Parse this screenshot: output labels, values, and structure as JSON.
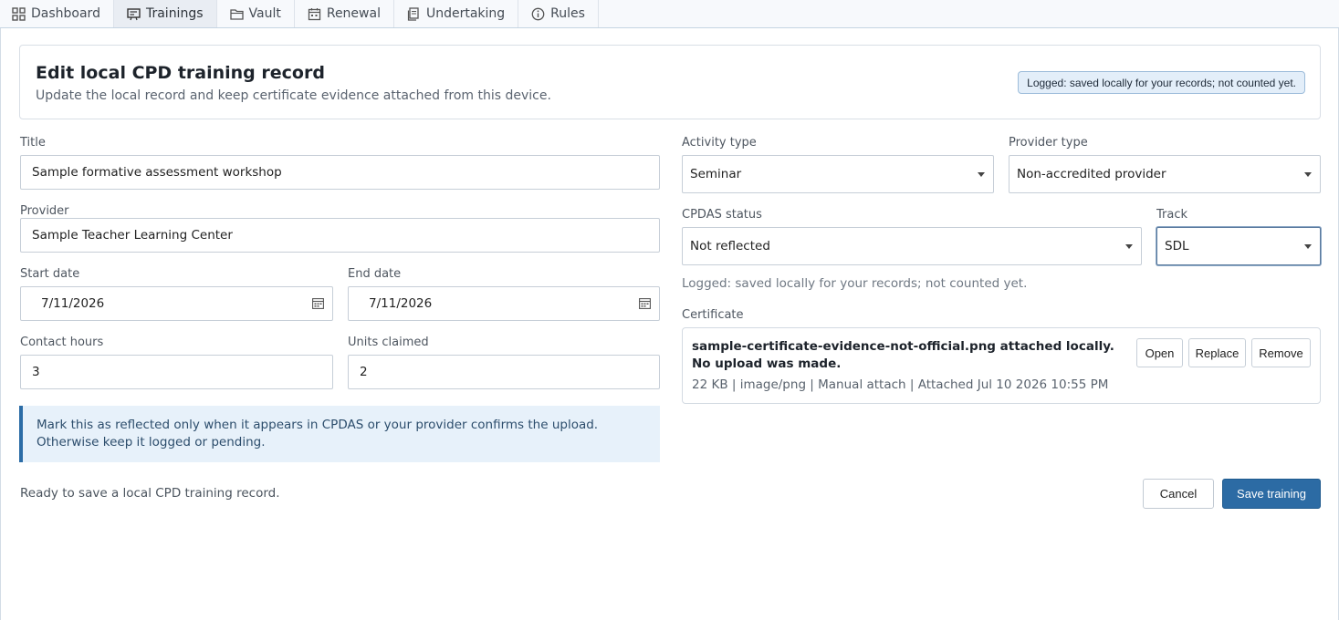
{
  "tabs": [
    {
      "label": "Dashboard",
      "icon": "grid-icon"
    },
    {
      "label": "Trainings",
      "icon": "training-icon",
      "active": true
    },
    {
      "label": "Vault",
      "icon": "folder-icon"
    },
    {
      "label": "Renewal",
      "icon": "calendar-icon"
    },
    {
      "label": "Undertaking",
      "icon": "document-icon"
    },
    {
      "label": "Rules",
      "icon": "info-icon"
    }
  ],
  "header": {
    "title": "Edit local CPD training record",
    "subtitle": "Update the local record and keep certificate evidence attached from this device.",
    "badge": "Logged: saved locally for your records; not counted yet."
  },
  "form": {
    "title": {
      "label": "Title",
      "value": "Sample formative assessment workshop"
    },
    "provider": {
      "label": "Provider",
      "value": "Sample Teacher Learning Center"
    },
    "start_date": {
      "label": "Start date",
      "value": "7/11/2026"
    },
    "end_date": {
      "label": "End date",
      "value": "7/11/2026"
    },
    "contact_hours": {
      "label": "Contact hours",
      "value": "3"
    },
    "units_claimed": {
      "label": "Units claimed",
      "value": "2"
    },
    "activity_type": {
      "label": "Activity type",
      "value": "Seminar"
    },
    "provider_type": {
      "label": "Provider type",
      "value": "Non-accredited provider"
    },
    "cpdas_status": {
      "label": "CPDAS status",
      "value": "Not reflected"
    },
    "track": {
      "label": "Track",
      "value": "SDL"
    }
  },
  "status_note": "Logged: saved locally for your records; not counted yet.",
  "notice": "Mark this as reflected only when it appears in CPDAS or your provider confirms the upload. Otherwise keep it logged or pending.",
  "certificate": {
    "label": "Certificate",
    "name": "sample-certificate-evidence-not-official.png attached locally. No upload was made.",
    "meta": "22 KB | image/png | Manual attach | Attached Jul 10 2026 10:55 PM",
    "open": "Open",
    "replace": "Replace",
    "remove": "Remove"
  },
  "status_line": "Ready to save a local CPD training record.",
  "actions": {
    "cancel": "Cancel",
    "save": "Save training"
  },
  "colors": {
    "accent": "#2c6ba4",
    "notice_bg": "#e7f1fa",
    "badge_bg": "#e3eef9"
  }
}
